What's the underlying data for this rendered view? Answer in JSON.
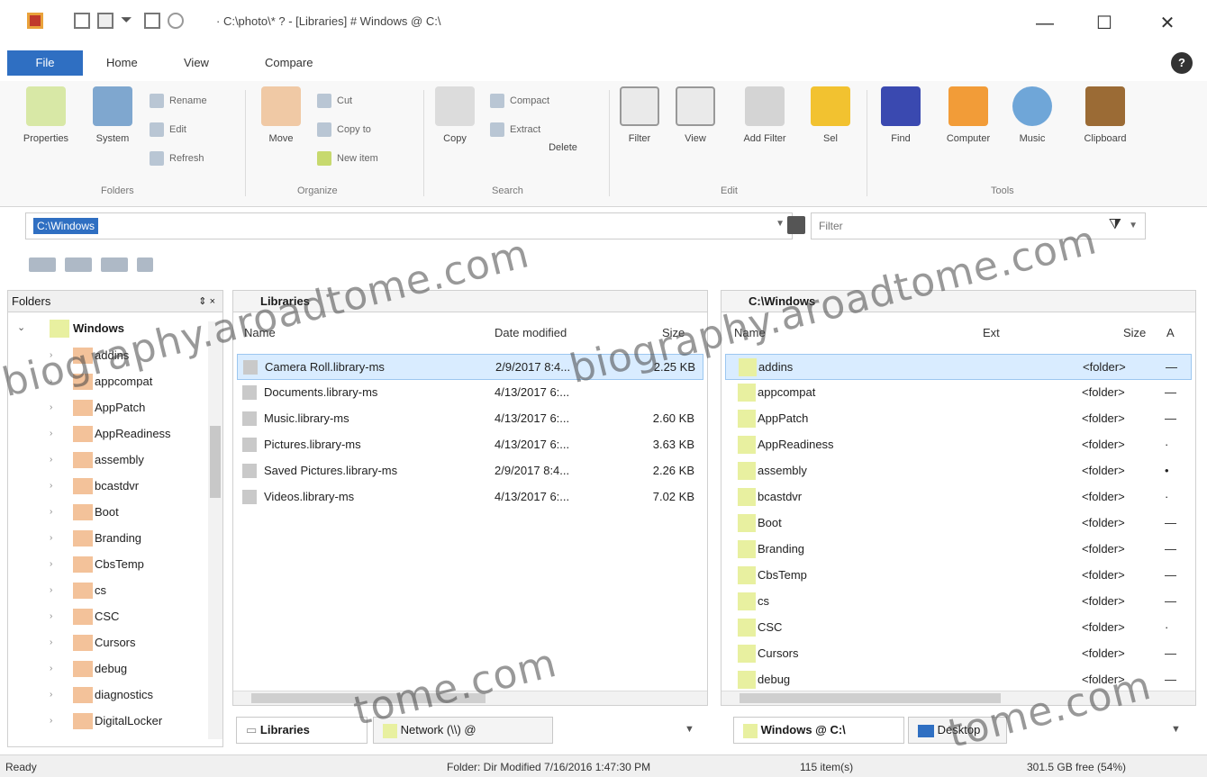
{
  "window": {
    "title": "· C:\\photo\\* ? - [Libraries] # Windows @ C:\\",
    "minimize_label": "—",
    "maximize_label": "☐",
    "close_label": "✕",
    "help_label": "?"
  },
  "ribbon": {
    "tabs": [
      "File",
      "Home",
      "View",
      "Compare"
    ],
    "big_buttons": [
      "Properties",
      "System",
      "Move",
      "Copy",
      "Delete",
      "Filter",
      "View",
      "Add Filter",
      "Sel",
      "Find",
      "Computer",
      "Music",
      "Clipboard"
    ],
    "small_buttons": [
      "Rename",
      "Edit",
      "Refresh",
      "Cut",
      "Copy to",
      "New item",
      "Compact",
      "Extract"
    ],
    "groups": [
      "Folders",
      "Organize",
      "Search",
      "Edit",
      "Tools"
    ]
  },
  "address": {
    "path": "C:\\Windows",
    "filter_placeholder": "Filter"
  },
  "tree": {
    "header": "Folders",
    "root": "Windows",
    "items": [
      "addins",
      "appcompat",
      "AppPatch",
      "AppReadiness",
      "assembly",
      "bcastdvr",
      "Boot",
      "Branding",
      "CbsTemp",
      "cs",
      "CSC",
      "Cursors",
      "debug",
      "diagnostics",
      "DigitalLocker"
    ]
  },
  "left_pane": {
    "title": "Libraries",
    "columns": [
      "Name",
      "Date modified",
      "Size"
    ],
    "rows": [
      {
        "name": "Camera Roll.library-ms",
        "date": "2/9/2017 8:4...",
        "size": "2.25 KB"
      },
      {
        "name": "Documents.library-ms",
        "date": "4/13/2017 6:...",
        "size": ""
      },
      {
        "name": "Music.library-ms",
        "date": "4/13/2017 6:...",
        "size": "2.60 KB"
      },
      {
        "name": "Pictures.library-ms",
        "date": "4/13/2017 6:...",
        "size": "3.63 KB"
      },
      {
        "name": "Saved Pictures.library-ms",
        "date": "2/9/2017 8:4...",
        "size": "2.26 KB"
      },
      {
        "name": "Videos.library-ms",
        "date": "4/13/2017 6:...",
        "size": "7.02 KB"
      }
    ]
  },
  "right_pane": {
    "title": "C:\\Windows",
    "columns": [
      "Name",
      "Ext",
      "Size",
      "A"
    ],
    "rows": [
      {
        "name": "addins",
        "size": "<folder>",
        "attr": "—"
      },
      {
        "name": "appcompat",
        "size": "<folder>",
        "attr": "—"
      },
      {
        "name": "AppPatch",
        "size": "<folder>",
        "attr": "—"
      },
      {
        "name": "AppReadiness",
        "size": "<folder>",
        "attr": "·"
      },
      {
        "name": "assembly",
        "size": "<folder>",
        "attr": "•"
      },
      {
        "name": "bcastdvr",
        "size": "<folder>",
        "attr": "·"
      },
      {
        "name": "Boot",
        "size": "<folder>",
        "attr": "—"
      },
      {
        "name": "Branding",
        "size": "<folder>",
        "attr": "—"
      },
      {
        "name": "CbsTemp",
        "size": "<folder>",
        "attr": "—"
      },
      {
        "name": "cs",
        "size": "<folder>",
        "attr": "—"
      },
      {
        "name": "CSC",
        "size": "<folder>",
        "attr": "·"
      },
      {
        "name": "Cursors",
        "size": "<folder>",
        "attr": "—"
      },
      {
        "name": "debug",
        "size": "<folder>",
        "attr": "—"
      }
    ]
  },
  "bottom_tabs": {
    "left": [
      "Libraries",
      "Network (\\\\) @"
    ],
    "right": [
      "Windows @ C:\\",
      "Desktop"
    ]
  },
  "status": {
    "ready": "Ready",
    "info": "Folder: Dir Modified 7/16/2016 1:47:30 PM",
    "count": "115 item(s)",
    "free": "301.5 GB free (54%)"
  },
  "watermark": {
    "text_main": "biography.aroadtome.com",
    "text_short": "tome.com"
  },
  "colors": {
    "accent": "#2f6fc2",
    "folder": "#e8f0a0",
    "tree_folder": "#f3c29a",
    "selected_row": "#d9ecff"
  }
}
